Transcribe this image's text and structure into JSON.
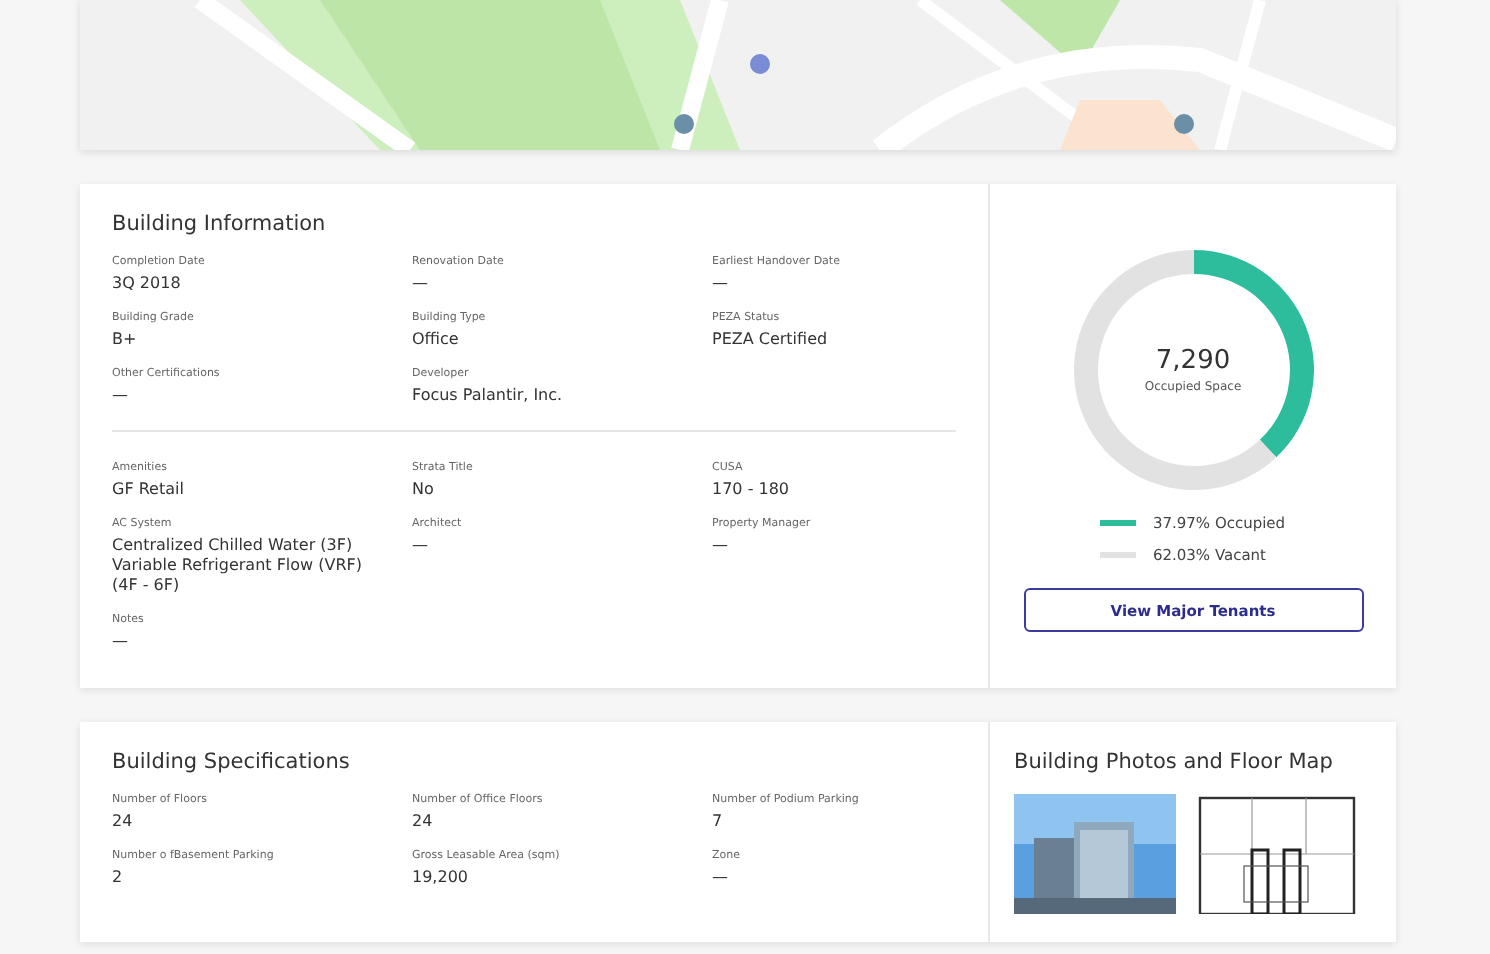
{
  "building_information": {
    "title": "Building Information",
    "fields": [
      {
        "label": "Completion Date",
        "value": "3Q 2018"
      },
      {
        "label": "Renovation Date",
        "value": "—"
      },
      {
        "label": "Earliest Handover Date",
        "value": "—"
      },
      {
        "label": "Building Grade",
        "value": "B+"
      },
      {
        "label": "Building Type",
        "value": "Office"
      },
      {
        "label": "PEZA Status",
        "value": "PEZA Certified"
      },
      {
        "label": "Other Certifications",
        "value": "—"
      },
      {
        "label": "Developer",
        "value": "Focus Palantir, Inc."
      }
    ],
    "details": [
      {
        "label": "Amenities",
        "value": "GF Retail"
      },
      {
        "label": "Strata Title",
        "value": "No"
      },
      {
        "label": "CUSA",
        "value": "170 - 180"
      },
      {
        "label": "AC System",
        "value": "Centralized Chilled Water (3F) Variable Refrigerant Flow (VRF) (4F - 6F)"
      },
      {
        "label": "Architect",
        "value": "—"
      },
      {
        "label": "Property Manager",
        "value": "—"
      },
      {
        "label": "Notes",
        "value": "—"
      }
    ]
  },
  "occupancy": {
    "chart_data": {
      "type": "donut",
      "categories": [
        "Occupied",
        "Vacant"
      ],
      "values": [
        37.97,
        62.03
      ]
    },
    "center_value": "7,290",
    "center_label": "Occupied Space",
    "legend": [
      {
        "percent": "37.97%",
        "color": "#2ebd9c"
      },
      {
        "percent": "62.03%",
        "color": "#e2e2e2"
      }
    ],
    "button": "View Major Tenants"
  },
  "building_specifications": {
    "title": "Building Specifications",
    "fields": [
      {
        "label": "Number of Floors",
        "value": "24"
      },
      {
        "label": "Number of Office Floors",
        "value": "24"
      },
      {
        "label": "Number of Podium Parking",
        "value": "7"
      },
      {
        "label": "Number o fBasement Parking",
        "value": "2"
      },
      {
        "label": "Gross Leasable Area (sqm)",
        "value": "19,200"
      },
      {
        "label": "Zone",
        "value": "—"
      }
    ]
  },
  "photos": {
    "title": "Building Photos and Floor Map"
  }
}
